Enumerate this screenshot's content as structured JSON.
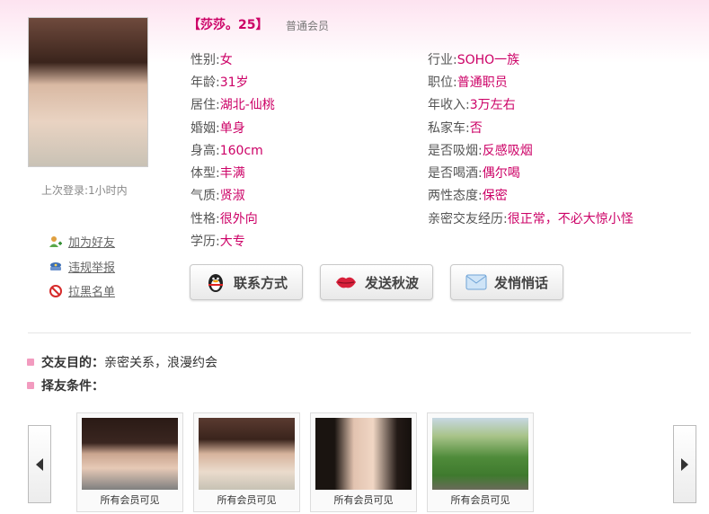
{
  "profile": {
    "name": "【莎莎。25】",
    "level": "普通会员",
    "last_login": "上次登录:1小时内"
  },
  "side_links": [
    {
      "label": "加为好友",
      "icon": "add-friend-icon"
    },
    {
      "label": "违规举报",
      "icon": "report-icon"
    },
    {
      "label": "拉黑名单",
      "icon": "block-icon"
    }
  ],
  "details_left": [
    {
      "label": "性别:",
      "value": "女"
    },
    {
      "label": "年龄:",
      "value": "31岁"
    },
    {
      "label": "居住:",
      "value": "湖北-仙桃"
    },
    {
      "label": "婚姻:",
      "value": "单身"
    },
    {
      "label": "身高:",
      "value": "160cm"
    },
    {
      "label": "体型:",
      "value": "丰满"
    },
    {
      "label": "气质:",
      "value": "贤淑"
    },
    {
      "label": "性格:",
      "value": "很外向"
    },
    {
      "label": "学历:",
      "value": "大专"
    }
  ],
  "details_right": [
    {
      "label": "行业:",
      "value": "SOHO一族"
    },
    {
      "label": "职位:",
      "value": "普通职员"
    },
    {
      "label": "年收入:",
      "value": "3万左右"
    },
    {
      "label": "私家车:",
      "value": "否"
    },
    {
      "label": "是否吸烟:",
      "value": "反感吸烟"
    },
    {
      "label": "是否喝酒:",
      "value": "偶尔喝"
    },
    {
      "label": "两性态度:",
      "value": "保密"
    },
    {
      "label": "亲密交友经历:",
      "value": "很正常，不必大惊小怪"
    }
  ],
  "buttons": {
    "contact": "联系方式",
    "wink": "发送秋波",
    "message": "发悄悄话"
  },
  "goals": {
    "purpose_label": "交友目的：",
    "purpose_value": "亲密关系，浪漫约会",
    "criteria_label": "择友条件："
  },
  "photos": [
    {
      "caption": "所有会员可见"
    },
    {
      "caption": "所有会员可见"
    },
    {
      "caption": "所有会员可见"
    },
    {
      "caption": "所有会员可见"
    }
  ],
  "colors": {
    "accent": "#cc0066",
    "header_gradient": "#fde3f0"
  }
}
